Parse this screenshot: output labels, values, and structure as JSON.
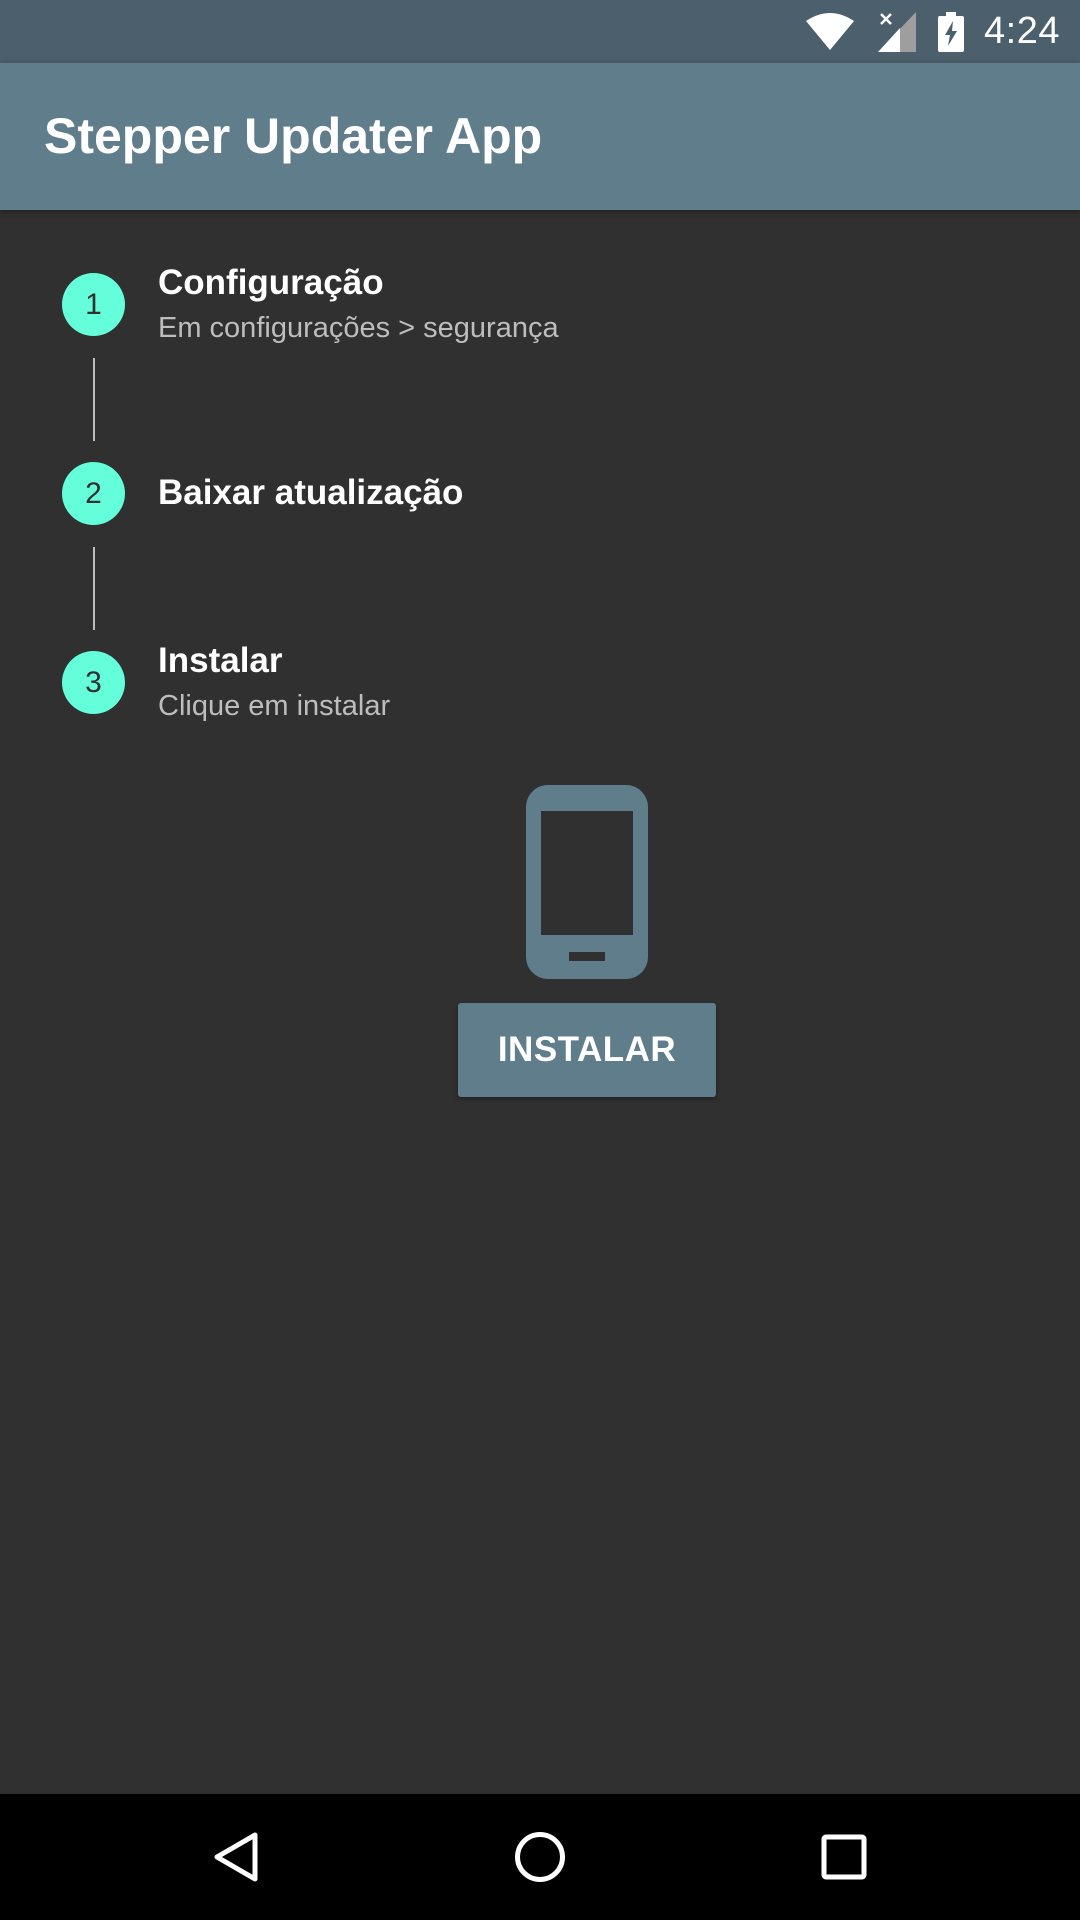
{
  "status_bar": {
    "time": "4:24",
    "icons": [
      "wifi-icon",
      "signal-icon",
      "battery-charging-icon"
    ]
  },
  "app_bar": {
    "title": "Stepper Updater App"
  },
  "steps": [
    {
      "number": "1",
      "title": "Configuração",
      "subtitle": "Em configurações > segurança"
    },
    {
      "number": "2",
      "title": "Baixar atualização",
      "subtitle": ""
    },
    {
      "number": "3",
      "title": "Instalar",
      "subtitle": "Clique em instalar"
    }
  ],
  "content": {
    "icon": "smartphone-icon",
    "button_label": "INSTALAR"
  },
  "nav_bar": {
    "icons": [
      "back-icon",
      "home-icon",
      "recents-icon"
    ]
  },
  "colors": {
    "status_bar": "#4c5f6c",
    "app_bar": "#607d8b",
    "background": "#303030",
    "step_circle": "#64ffda",
    "button": "#607d8b",
    "nav_bar": "#000000"
  }
}
